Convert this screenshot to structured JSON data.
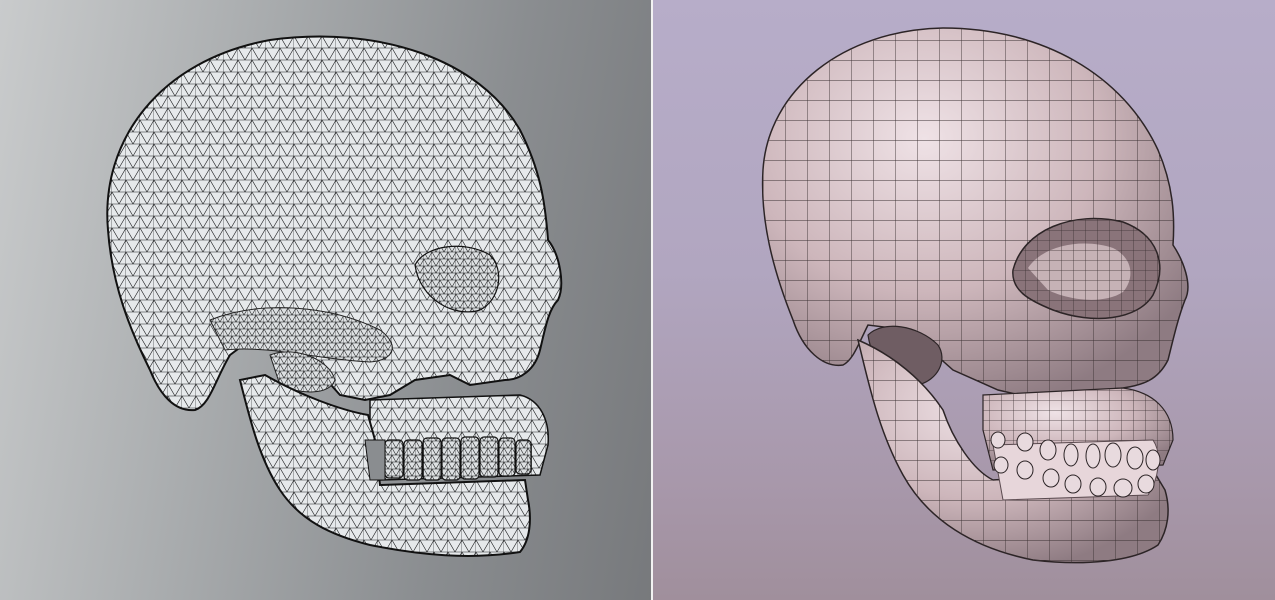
{
  "scene": {
    "left_panel": {
      "subject": "skull-triangle-wireframe",
      "background_colors": [
        "#c9cbcc",
        "#77797c"
      ],
      "surface_color": "#e4e7e9",
      "wire_color": "#1b1c1e"
    },
    "right_panel": {
      "subject": "skull-quad-retopology",
      "background_colors": [
        "#b7adc9",
        "#a08f9c"
      ],
      "surface_color": "#cfb8bc",
      "wire_color": "#3a3032"
    },
    "divider_color": "#f2f2f2"
  }
}
